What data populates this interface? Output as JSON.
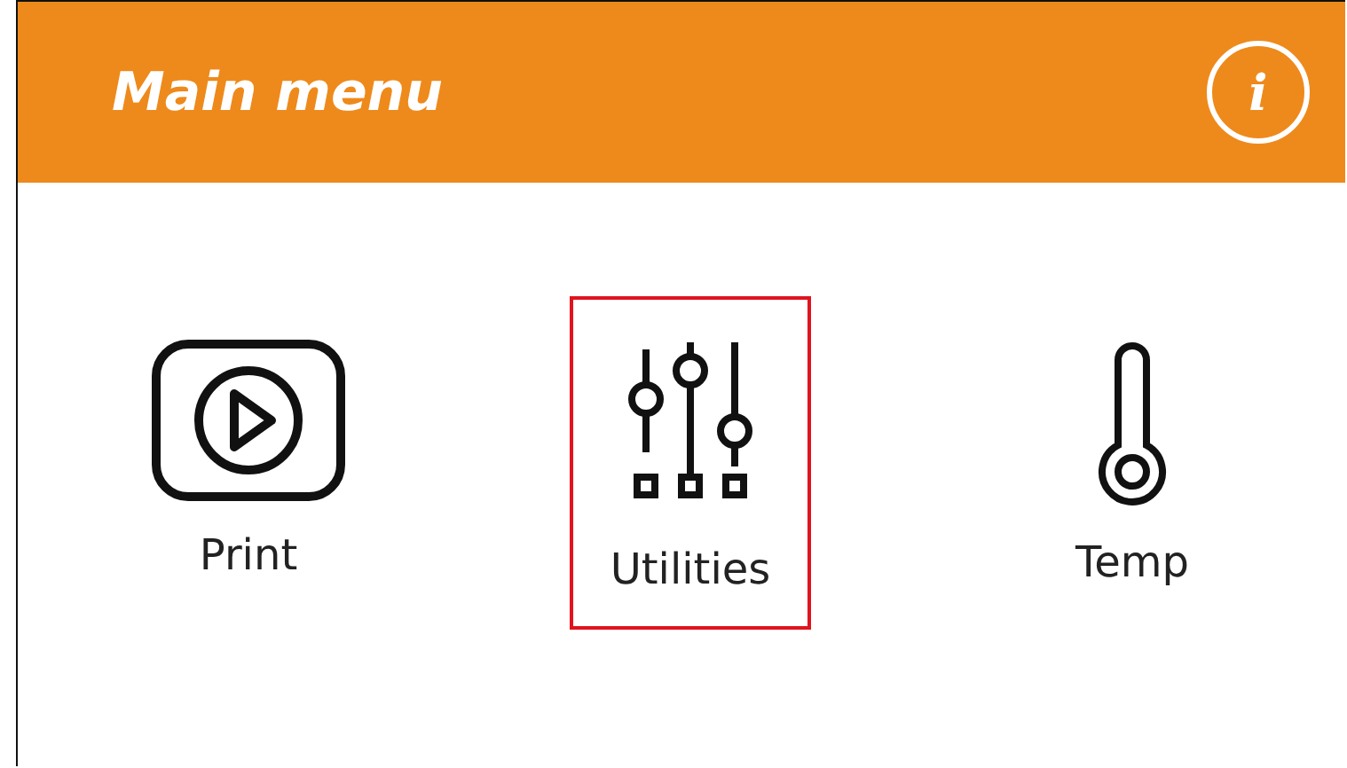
{
  "header": {
    "title": "Main menu",
    "info_button": "i"
  },
  "items": [
    {
      "kind": "play",
      "label": "Print",
      "selected": false
    },
    {
      "kind": "sliders",
      "label": "Utilities",
      "selected": true
    },
    {
      "kind": "thermometer",
      "label": "Temp",
      "selected": false
    }
  ]
}
